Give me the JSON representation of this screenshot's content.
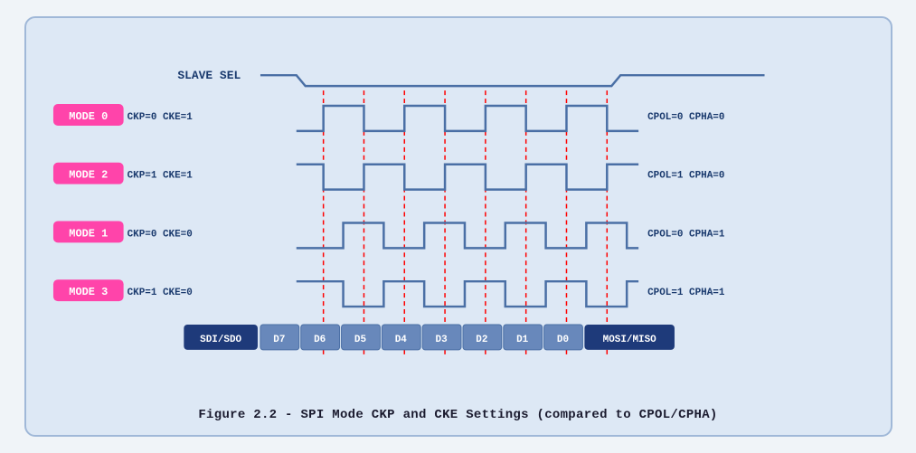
{
  "caption": "Figure 2.2 - SPI Mode CKP and CKE Settings (compared to CPOL/CPHA)",
  "diagram": {
    "slave_sel_label": "SLAVE SEL",
    "mode0_label": "MODE 0",
    "mode1_label": "MODE 1",
    "mode2_label": "MODE 2",
    "mode3_label": "MODE 3",
    "mode0_params": "CKP=0  CKE=1",
    "mode1_params": "CKP=0  CKE=0",
    "mode2_params": "CKP=1  CKE=1",
    "mode3_params": "CKP=1  CKE=0",
    "mode0_right": "CPOL=0  CPHA=0",
    "mode1_right": "CPOL=0  CPHA=1",
    "mode2_right": "CPOL=1  CPHA=0",
    "mode3_right": "CPOL=1  CPHA=1",
    "data_bits": [
      "SDI/SDO",
      "D7",
      "D6",
      "D5",
      "D4",
      "D3",
      "D2",
      "D1",
      "D0",
      "MOSI/MISO"
    ]
  }
}
